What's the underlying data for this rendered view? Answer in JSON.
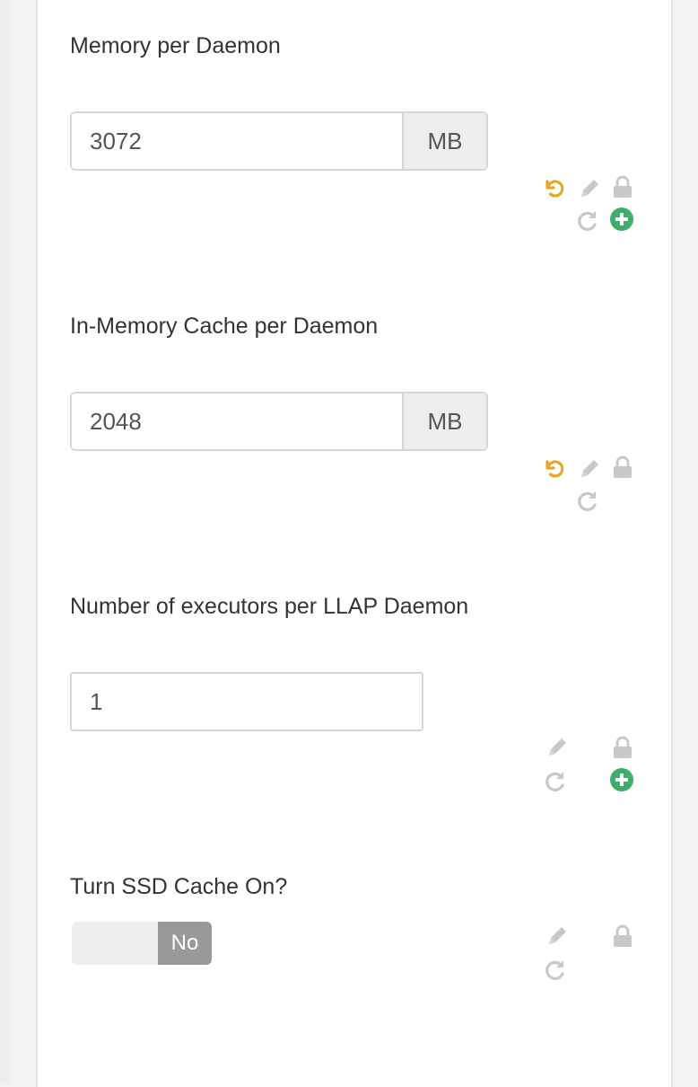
{
  "colors": {
    "undo": "#e8a726",
    "icon_gray": "#bdbdbd",
    "add": "#3fae6b",
    "toggle_off": "#999999"
  },
  "configs": [
    {
      "label": "Memory per Daemon",
      "value": "3072",
      "unit": "MB"
    },
    {
      "label": "In-Memory Cache per Daemon",
      "value": "2048",
      "unit": "MB"
    },
    {
      "label": "Number of executors per LLAP Daemon",
      "value": "1"
    },
    {
      "label": "Turn SSD Cache On?",
      "toggle_label": "No",
      "toggle_state": "off"
    }
  ],
  "icons": {
    "undo": "undo-icon",
    "edit": "pencil-icon",
    "lock": "lock-icon",
    "refresh": "refresh-icon",
    "add": "add-circle-icon"
  }
}
